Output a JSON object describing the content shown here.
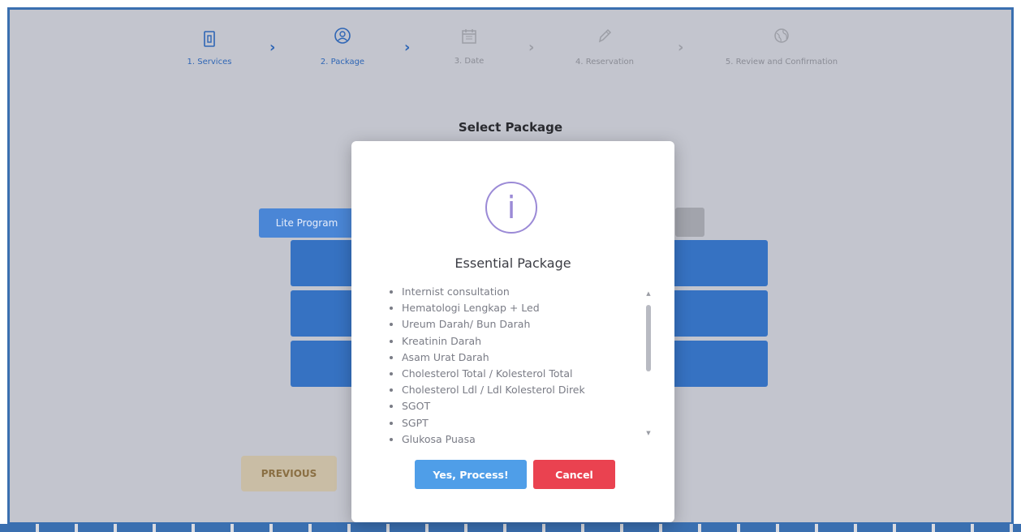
{
  "stepper": {
    "steps": [
      {
        "label": "1. Services",
        "icon": "document-icon",
        "state": "active"
      },
      {
        "label": "2. Package",
        "icon": "user-icon",
        "state": "active"
      },
      {
        "label": "3. Date",
        "icon": "calendar-icon",
        "state": "inactive"
      },
      {
        "label": "4. Reservation",
        "icon": "pencil-icon",
        "state": "inactive"
      },
      {
        "label": "5. Review and Confirmation",
        "icon": "globe-icon",
        "state": "inactive"
      }
    ]
  },
  "page": {
    "title": "Select Package",
    "tab_label": "Lite Program",
    "previous_label": "PREVIOUS"
  },
  "modal": {
    "icon": "info-icon",
    "icon_glyph": "i",
    "title": "Essential Package",
    "items": [
      "Internist consultation",
      "Hematologi Lengkap + Led",
      "Ureum Darah/ Bun Darah",
      "Kreatinin Darah",
      "Asam Urat Darah",
      "Cholesterol Total / Kolesterol Total",
      "Cholesterol Ldl / Ldl Kolesterol Direk",
      "SGOT",
      "SGPT",
      "Glukosa Puasa"
    ],
    "confirm_label": "Yes, Process!",
    "cancel_label": "Cancel"
  },
  "colors": {
    "primary": "#2f66b5",
    "confirm": "#4f9ee8",
    "cancel": "#ea4250",
    "info_icon": "#9b8ad6"
  }
}
